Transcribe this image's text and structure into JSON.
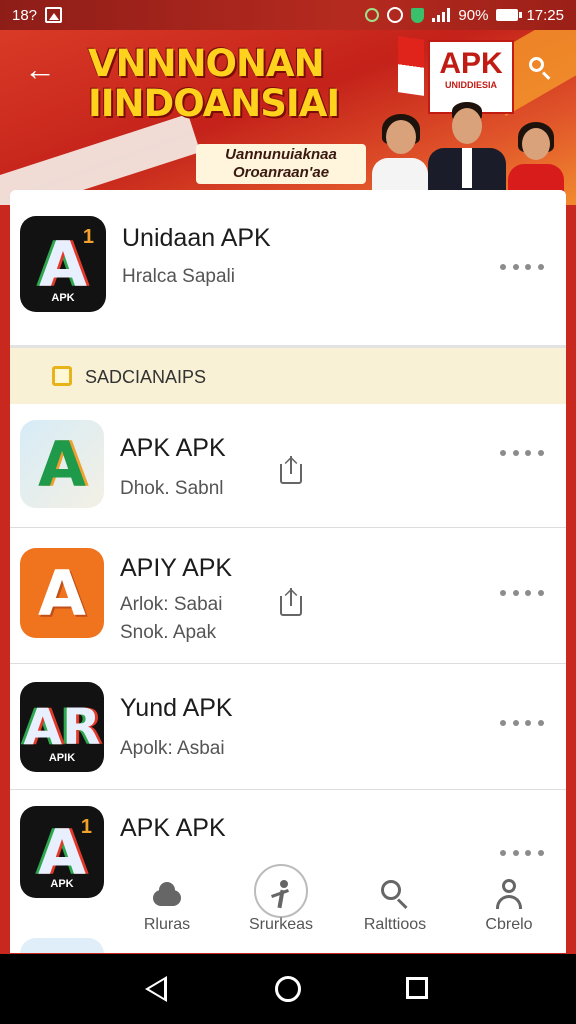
{
  "status_bar": {
    "time_left": "18?",
    "battery_pct": "90%",
    "clock": "17:25"
  },
  "banner": {
    "title_line1": "VNNNONAN",
    "title_line2": "IINDOANSIAI",
    "subtitle_line1": "Uannunuiaknaa",
    "subtitle_line2": "Oroanraan'ae",
    "badge_main": "APK",
    "badge_sub": "UNIDDIESIA"
  },
  "featured": {
    "name": "Unidaan APK",
    "subtitle": "Hralca Sapali"
  },
  "section": {
    "label": "SADCIANAIPS"
  },
  "apps": [
    {
      "name": "APK APK",
      "line1": "Dhok. Sabnl",
      "line2": "",
      "icon_letter": "A",
      "icon_small": ""
    },
    {
      "name": "APIY APK",
      "line1": "Arlok: Sabai",
      "line2": "Snok. Apak",
      "icon_letter": "A",
      "icon_small": ""
    },
    {
      "name": "Yund APK",
      "line1": "Apolk: Asbai",
      "line2": "",
      "icon_letter": "AR",
      "icon_small": "APIK"
    },
    {
      "name": "APK APK",
      "line1": "",
      "line2": "",
      "icon_letter": "A",
      "icon_small": "APK"
    }
  ],
  "bottom_nav": [
    {
      "label": "Rluras",
      "icon": "cloud-icon"
    },
    {
      "label": "Srurkeas",
      "icon": "person-run-icon"
    },
    {
      "label": "Ralttioos",
      "icon": "search-icon"
    },
    {
      "label": "Cbrelo",
      "icon": "profile-icon"
    }
  ],
  "colors": {
    "accent_red": "#c8281e",
    "banner_yellow": "#ffd21e",
    "section_bg": "#f8f1d6",
    "orange_icon": "#f0731e"
  }
}
